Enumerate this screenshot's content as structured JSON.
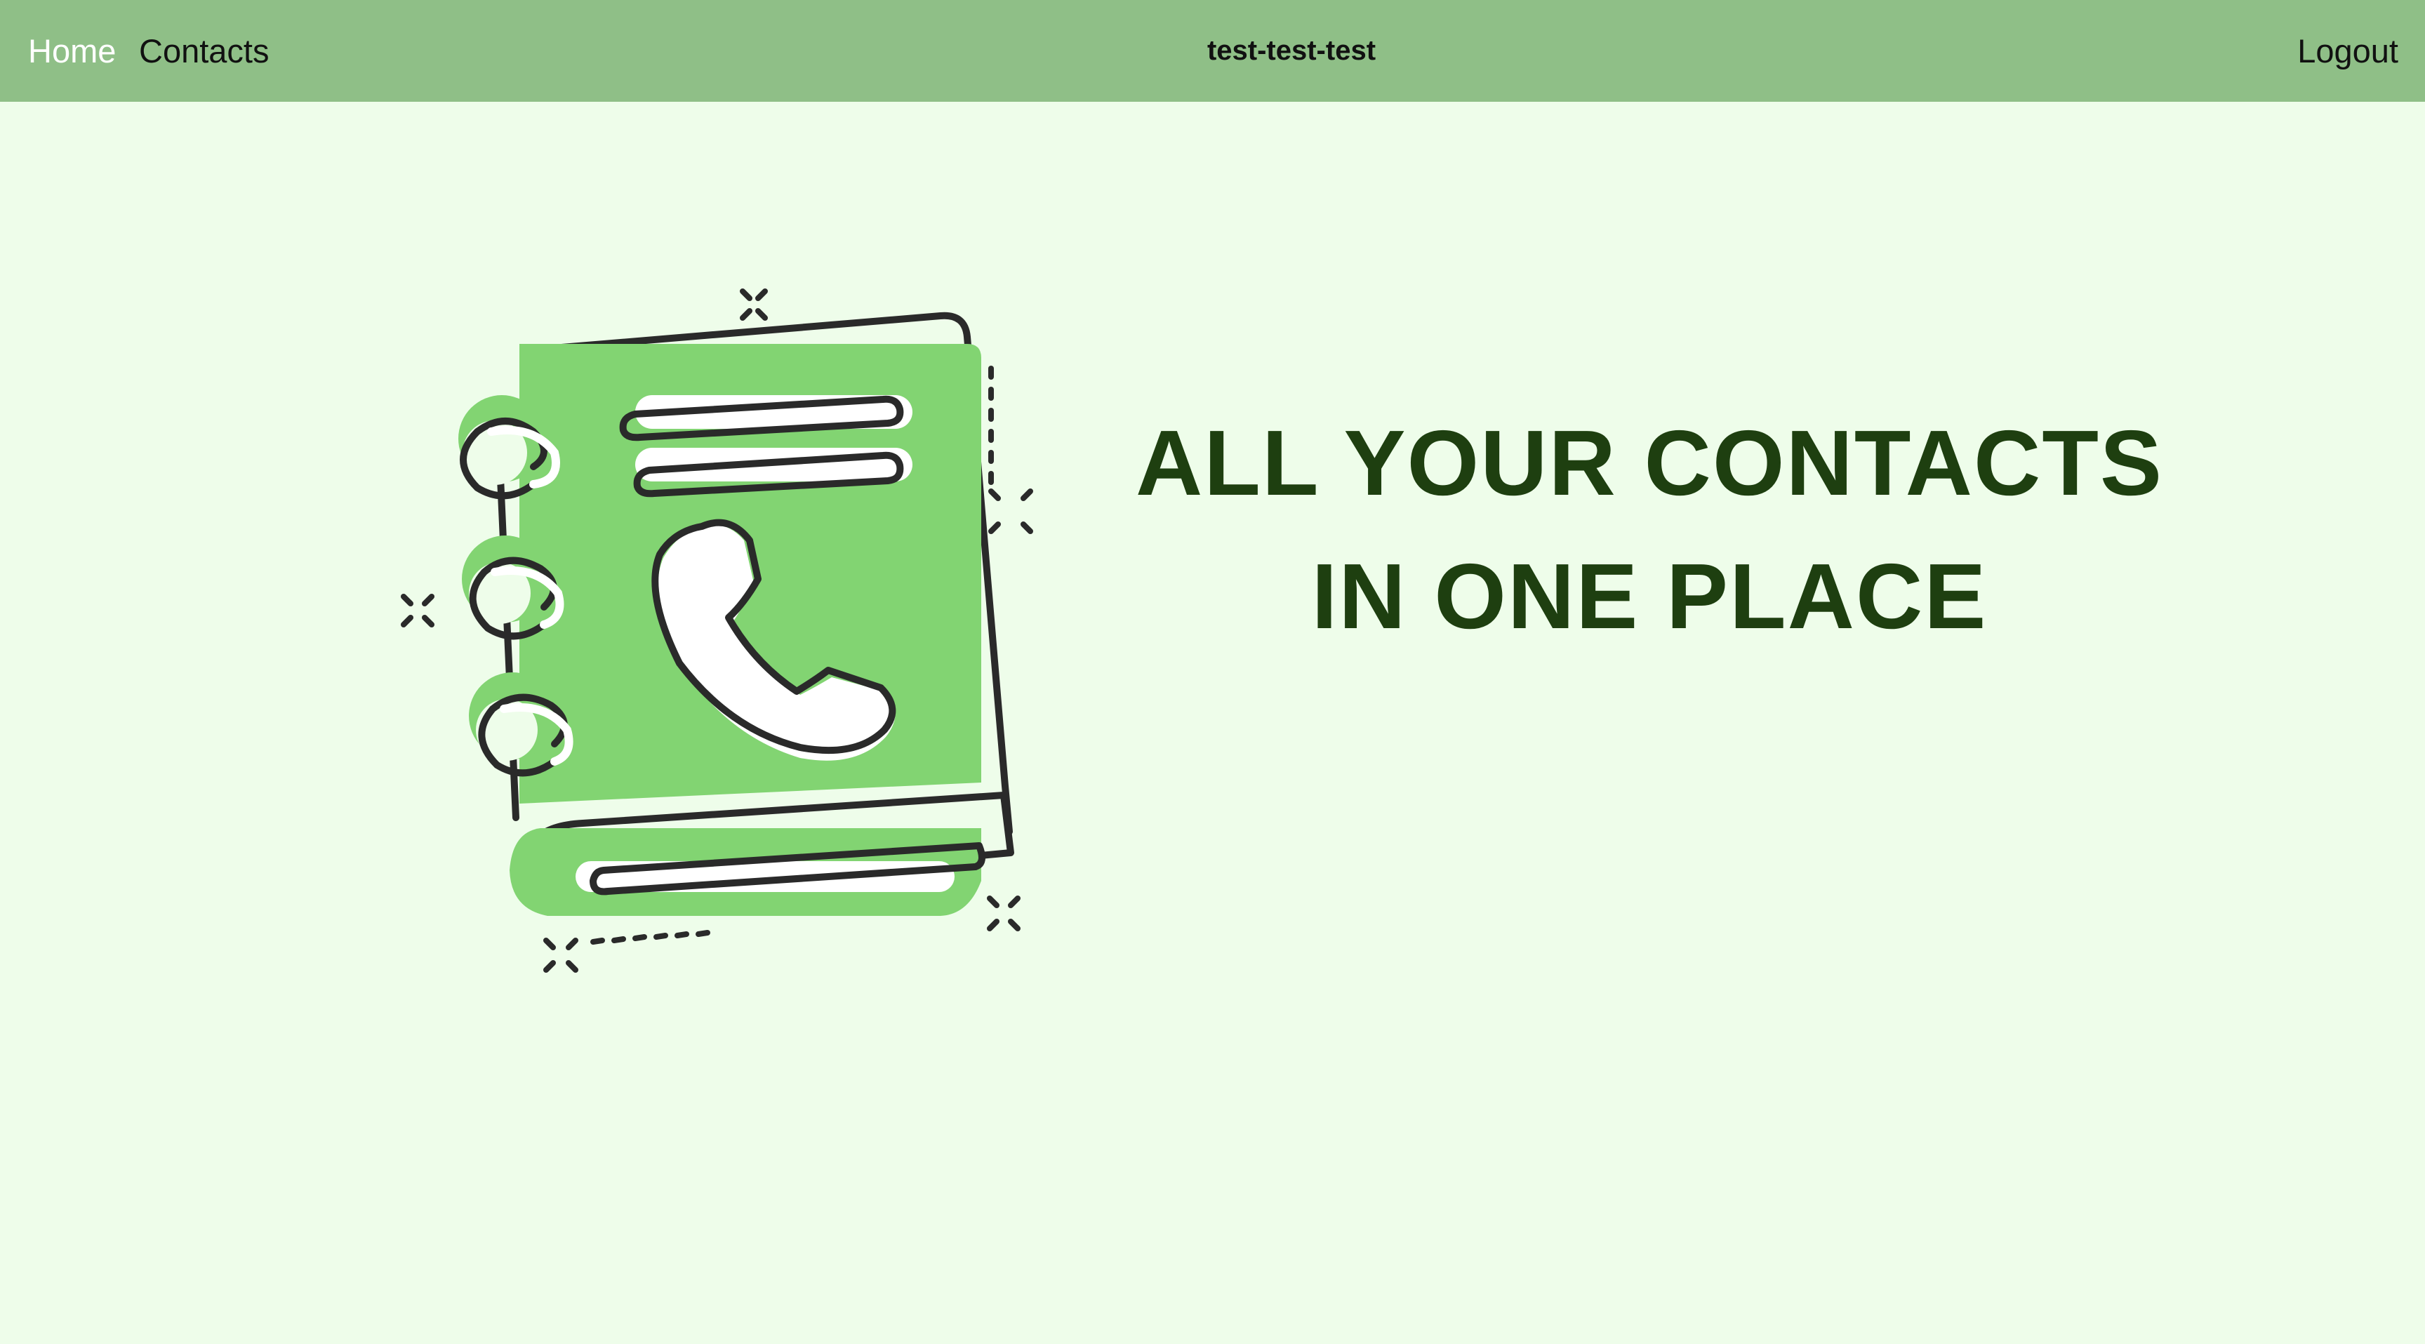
{
  "navbar": {
    "home_label": "Home",
    "contacts_label": "Contacts",
    "brand": "test-test-test",
    "logout_label": "Logout"
  },
  "hero": {
    "headline_line1": "ALL YOUR CONTACTS",
    "headline_line2": "IN ONE PLACE",
    "illustration_icon": "address-book-phone-icon"
  },
  "colors": {
    "navbar_bg": "#8fbf87",
    "page_bg": "#eefdea",
    "headline": "#1e3f10",
    "illustration_green": "#82d472",
    "outline": "#2a2a2a"
  }
}
